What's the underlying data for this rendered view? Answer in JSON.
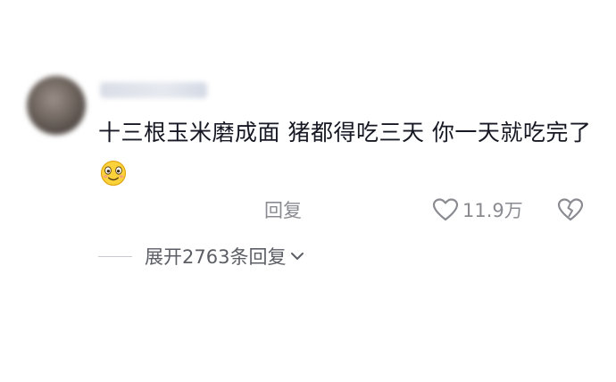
{
  "comment": {
    "text": "十三根玉米磨成面  猪都得吃三天    你一天就吃完了",
    "emoji": "blushing-smile-emoji"
  },
  "actions": {
    "reply_label": "回复",
    "like_count": "11.9万",
    "like_icon": "heart-outline-icon",
    "dislike_icon": "broken-heart-icon"
  },
  "replies": {
    "expand_label": "展开2763条回复",
    "expand_icon": "chevron-down-icon"
  },
  "colors": {
    "text": "#161823",
    "secondary": "#8a8b91",
    "expand_text": "#5c5e66"
  }
}
